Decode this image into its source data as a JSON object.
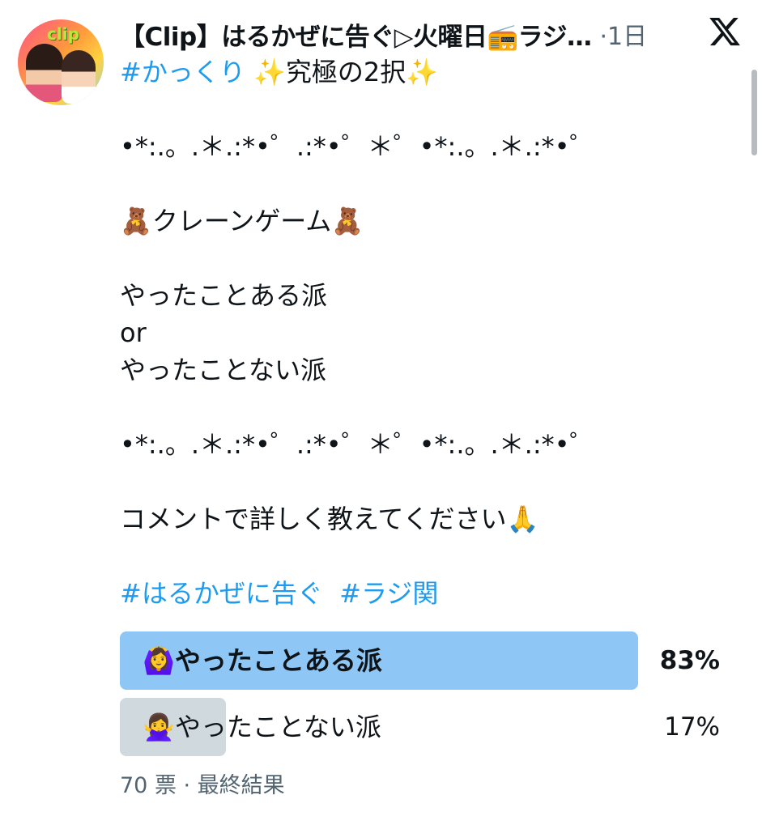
{
  "tweet": {
    "author": "【Clip】はるかぜに告ぐ▷火曜日📻ラジ…",
    "time": "·1日",
    "lines": [
      {
        "text": "#かっくり",
        "type": "hashtag"
      },
      {
        "text": "",
        "type": "blank"
      },
      {
        "text": "•*:.。.＊.:*•゜.:*•゜＊゜•*:.。.＊.:*•゜",
        "type": "text"
      },
      {
        "text": "",
        "type": "blank"
      },
      {
        "text": "🧸クレーンゲーム🧸",
        "type": "text"
      },
      {
        "text": "",
        "type": "blank"
      },
      {
        "text": "やったことある派",
        "type": "text"
      },
      {
        "text": "or",
        "type": "text"
      },
      {
        "text": "やったことない派",
        "type": "text"
      },
      {
        "text": "",
        "type": "blank"
      },
      {
        "text": "•*:.。.＊.:*•゜.:*•゜＊゜•*:.。.＊.:*•゜",
        "type": "text"
      },
      {
        "text": "",
        "type": "blank"
      },
      {
        "text": "コメントで詳しく教えてください🙏",
        "type": "text"
      },
      {
        "text": "",
        "type": "blank"
      },
      {
        "text": "#はるかぜに告ぐ  #ラジ関",
        "type": "hashtag"
      }
    ],
    "first_line_suffix": " ✨究極の2択✨"
  },
  "poll": {
    "options": [
      {
        "label": "🙆‍♀️やったことある派",
        "percent": 83,
        "percent_label": "83%",
        "winner": true
      },
      {
        "label": "🙅‍♀️やったことない派",
        "percent": 17,
        "percent_label": "17%",
        "winner": false
      }
    ],
    "meta": "70 票 · 最終結果"
  },
  "colors": {
    "link": "#1d9bf0",
    "poll_winner": "#8ec7f5",
    "poll_other": "#cfd9de",
    "secondary_text": "#536471"
  },
  "icons": {
    "brand": "x-logo-icon"
  }
}
